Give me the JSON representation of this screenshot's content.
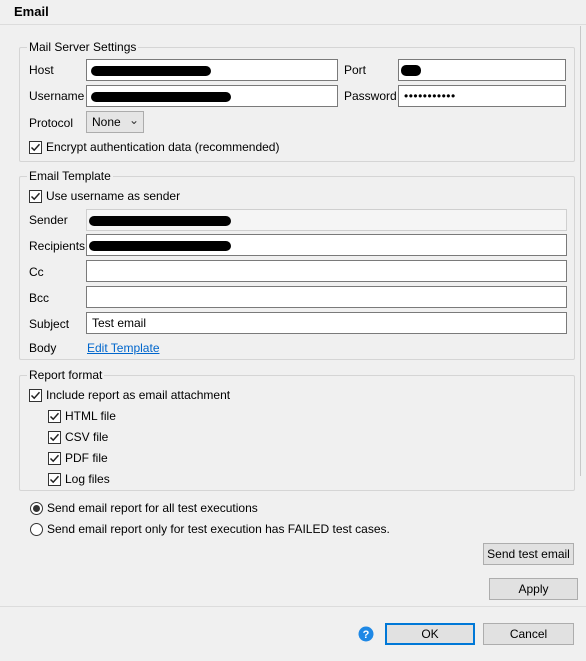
{
  "dialog": {
    "title": "Email"
  },
  "mail_server": {
    "group_label": "Mail Server Settings",
    "host_label": "Host",
    "port_label": "Port",
    "username_label": "Username",
    "password_label": "Password",
    "password_value": "•••••••••••",
    "protocol_label": "Protocol",
    "protocol_value": "None",
    "encrypt_label": "Encrypt authentication data (recommended)",
    "encrypt_checked": true
  },
  "template": {
    "group_label": "Email Template",
    "use_username_label": "Use username as sender",
    "use_username_checked": true,
    "sender_label": "Sender",
    "recipients_label": "Recipients",
    "cc_label": "Cc",
    "bcc_label": "Bcc",
    "subject_label": "Subject",
    "subject_value": "Test email",
    "body_label": "Body",
    "edit_template_link": "Edit Template"
  },
  "report_format": {
    "group_label": "Report format",
    "include_attachment_label": "Include report as email attachment",
    "include_attachment_checked": true,
    "files": [
      {
        "label": "HTML file",
        "checked": true
      },
      {
        "label": "CSV file",
        "checked": true
      },
      {
        "label": "PDF file",
        "checked": true
      },
      {
        "label": "Log files",
        "checked": true
      }
    ]
  },
  "send_options": {
    "all_executions_label": "Send email report for all test executions",
    "failed_only_label": "Send email report only for test execution has FAILED test cases.",
    "selected": "all"
  },
  "buttons": {
    "send_test_email": "Send test email",
    "apply": "Apply",
    "ok": "OK",
    "cancel": "Cancel"
  },
  "colors": {
    "link": "#0066cc",
    "help_icon": "#1e88e5",
    "default_button_border": "#0078d7"
  }
}
